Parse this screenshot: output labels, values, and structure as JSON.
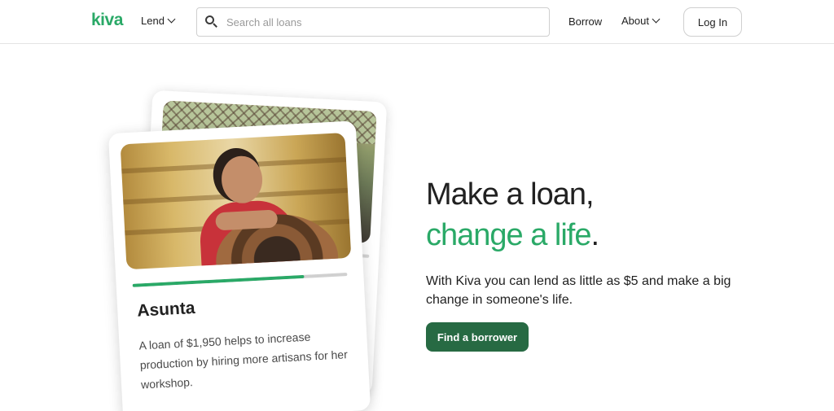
{
  "header": {
    "logo": "kiva",
    "nav_lend": "Lend",
    "search_placeholder": "Search all loans",
    "nav_borrow": "Borrow",
    "nav_about": "About",
    "login_label": "Log In"
  },
  "hero": {
    "line1": "Make a loan,",
    "line2_green": "change a life",
    "line2_end": ".",
    "subtitle": "With Kiva you can lend as little as $5 and make a big change in someone's life.",
    "cta_label": "Find a borrower"
  },
  "loan_card": {
    "name": "Asunta",
    "description": "A loan of $1,950 helps to increase production by hiring more artisans for her workshop.",
    "funded_fraction": 0.8
  },
  "colors": {
    "brand_green": "#2aa967",
    "cta_green": "#276a43"
  },
  "icons": [
    "search-icon",
    "chevron-down-icon"
  ]
}
